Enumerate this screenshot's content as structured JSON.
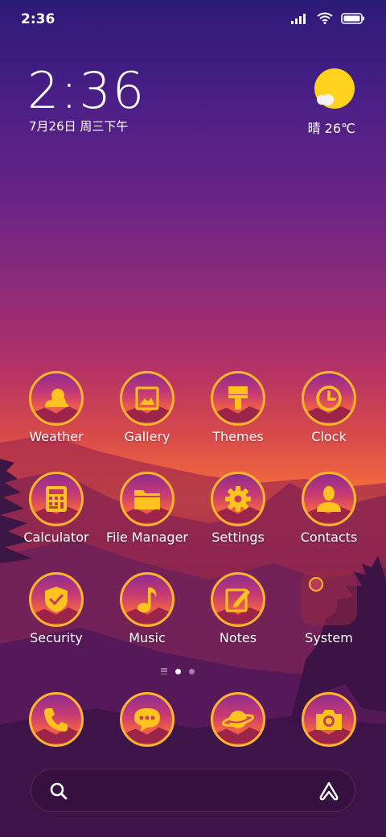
{
  "status_bar": {
    "time": "2:36"
  },
  "clock_widget": {
    "time": "2:36",
    "date": "7月26日 周三下午"
  },
  "weather_widget": {
    "text": "晴 26℃"
  },
  "apps": [
    {
      "label": "Weather",
      "icon": "weather-icon"
    },
    {
      "label": "Gallery",
      "icon": "gallery-icon"
    },
    {
      "label": "Themes",
      "icon": "themes-icon"
    },
    {
      "label": "Clock",
      "icon": "clock-icon"
    },
    {
      "label": "Calculator",
      "icon": "calculator-icon"
    },
    {
      "label": "File Manager",
      "icon": "folder-icon"
    },
    {
      "label": "Settings",
      "icon": "gear-icon"
    },
    {
      "label": "Contacts",
      "icon": "contacts-icon"
    },
    {
      "label": "Security",
      "icon": "shield-icon"
    },
    {
      "label": "Music",
      "icon": "music-note-icon"
    },
    {
      "label": "Notes",
      "icon": "notes-icon"
    },
    {
      "label": "System",
      "icon": "folder-system-icon"
    }
  ],
  "dock": [
    {
      "icon": "phone-icon"
    },
    {
      "icon": "message-icon"
    },
    {
      "icon": "planet-icon"
    },
    {
      "icon": "camera-icon"
    }
  ],
  "page_indicator": {
    "current_page": 1
  },
  "colors": {
    "icon_ring": "#ffb52c",
    "glyph": "#ffc21e"
  }
}
